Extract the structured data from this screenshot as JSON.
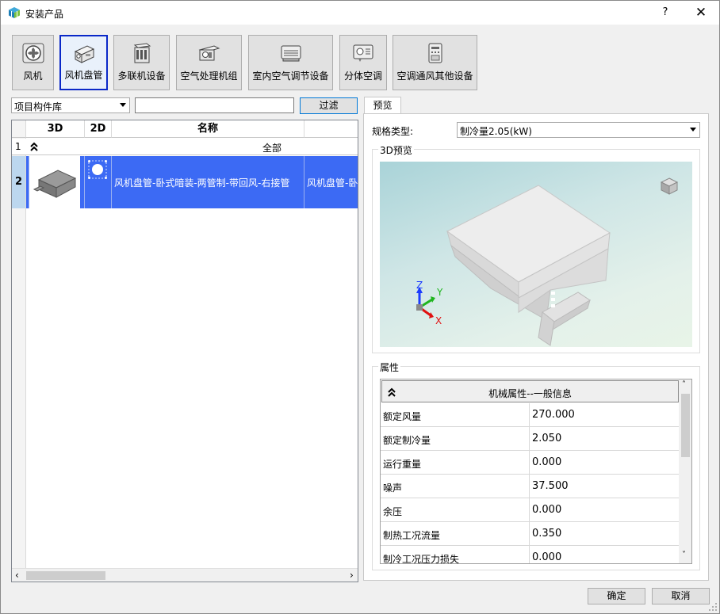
{
  "window": {
    "title": "安装产品",
    "help": "?",
    "close": "✕"
  },
  "categories": [
    {
      "label": "风机",
      "icon": "fan-icon"
    },
    {
      "label": "风机盘管",
      "icon": "fan-coil-icon"
    },
    {
      "label": "多联机设备",
      "icon": "vrf-icon"
    },
    {
      "label": "空气处理机组",
      "icon": "ahu-icon"
    },
    {
      "label": "室内空气调节设备",
      "icon": "indoor-ac-icon"
    },
    {
      "label": "分体空调",
      "icon": "split-ac-icon"
    },
    {
      "label": "空调通风其他设备",
      "icon": "hvac-other-icon"
    }
  ],
  "selected_category": "风机盘管",
  "library": {
    "selected": "项目构件库"
  },
  "filter": {
    "value": "",
    "button": "过滤"
  },
  "table": {
    "columns": [
      "3D",
      "2D",
      "名称"
    ],
    "filter_row": {
      "num": "1",
      "collapse": "⌃",
      "value": "全部"
    },
    "rows": [
      {
        "num": "2",
        "name": "风机盘管-卧式暗装-两管制-带回风-右接管",
        "name_next": "风机盘管-卧"
      }
    ]
  },
  "preview": {
    "tab": "预览",
    "spec_label": "规格类型:",
    "spec_value": "制冷量2.05(kW)",
    "group_3d": "3D预览",
    "axis_x": "X",
    "axis_y": "Y",
    "axis_z": "Z"
  },
  "properties": {
    "group": "属性",
    "section": "机械属性--一般信息",
    "rows": [
      {
        "key": "额定风量",
        "value": "270.000"
      },
      {
        "key": "额定制冷量",
        "value": "2.050"
      },
      {
        "key": "运行重量",
        "value": "0.000"
      },
      {
        "key": "噪声",
        "value": "37.500"
      },
      {
        "key": "余压",
        "value": "0.000"
      },
      {
        "key": "制热工况流量",
        "value": "0.350"
      },
      {
        "key": "制冷工况压力损失",
        "value": "0.000"
      }
    ]
  },
  "buttons": {
    "ok": "确定",
    "cancel": "取消"
  },
  "colors": {
    "selection": "#3c6af4",
    "accent": "#0078d7"
  }
}
